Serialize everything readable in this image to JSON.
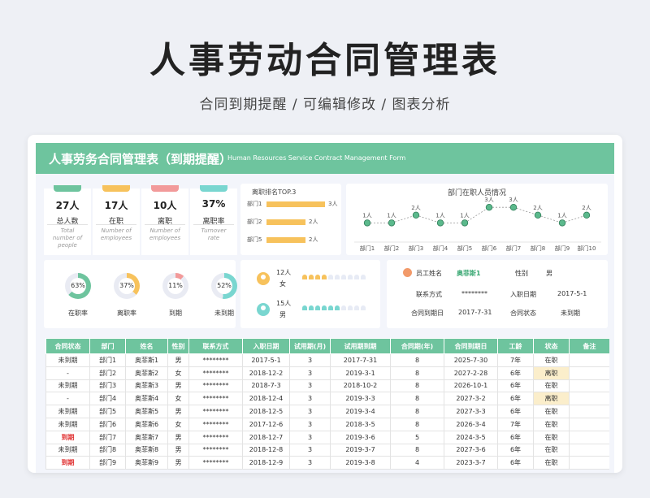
{
  "page": {
    "title": "人事劳动合同管理表",
    "subtitle": "合同到期提醒 /  可编辑修改  /  图表分析"
  },
  "banner": {
    "title": "人事劳务合同管理表（到期提醒）",
    "subtitle": "Human Resources Service Contract Management Form"
  },
  "kpis": [
    {
      "value": "27人",
      "label": "总人数",
      "en": "Total number of people",
      "color": "#6ec49e"
    },
    {
      "value": "17人",
      "label": "在职",
      "en": "Number of employees",
      "color": "#f7c25c"
    },
    {
      "value": "10人",
      "label": "离职",
      "en": "Number of employees",
      "color": "#f29a9a"
    },
    {
      "value": "37%",
      "label": "离职率",
      "en": "Turnover rate",
      "color": "#79d6d0"
    }
  ],
  "top3": {
    "title": "离职排名TOP.3",
    "items": [
      {
        "name": "部门1",
        "value": 3,
        "label": "3人"
      },
      {
        "name": "部门2",
        "value": 2,
        "label": "2人"
      },
      {
        "name": "部门5",
        "value": 2,
        "label": "2人"
      }
    ],
    "color": "#f7c25c"
  },
  "chart_data": {
    "type": "line",
    "title": "部门在职人员情况",
    "categories": [
      "部门1",
      "部门2",
      "部门3",
      "部门4",
      "部门5",
      "部门6",
      "部门7",
      "部门8",
      "部门9",
      "部门10"
    ],
    "values": [
      1,
      1,
      2,
      1,
      1,
      3,
      3,
      2,
      1,
      2
    ],
    "labels": [
      "1人",
      "1人",
      "2人",
      "1人",
      "1人",
      "3人",
      "3人",
      "2人",
      "1人",
      "2人"
    ],
    "color": "#5bb98c",
    "ylim": [
      0,
      3
    ]
  },
  "donuts": [
    {
      "percent": 63,
      "text": "63%",
      "label": "在职率",
      "color": "#6ec49e"
    },
    {
      "percent": 37,
      "text": "37%",
      "label": "离职率",
      "color": "#f7c25c"
    },
    {
      "percent": 11,
      "text": "11%",
      "label": "到期",
      "color": "#f29a9a"
    },
    {
      "percent": 52,
      "text": "52%",
      "label": "未到期",
      "color": "#79d6d0"
    }
  ],
  "gender": [
    {
      "count": "12人",
      "label": "女",
      "color": "#f7c25c",
      "fraction": 0.44
    },
    {
      "count": "15人",
      "label": "男",
      "color": "#79d6d0",
      "fraction": 0.56
    }
  ],
  "info": {
    "name_label": "员工姓名",
    "name_value": "奥菲斯1",
    "gender_label": "性别",
    "gender_value": "男",
    "contact_label": "联系方式",
    "contact_value": "********",
    "entry_label": "入职日期",
    "entry_value": "2017-5-1",
    "expire_label": "合同到期日",
    "expire_value": "2017-7-31",
    "status_label": "合同状态",
    "status_value": "未到期"
  },
  "table": {
    "headers": [
      "合同状态",
      "部门",
      "姓名",
      "性别",
      "联系方式",
      "入职日期",
      "试用期(月)",
      "试用期到期",
      "合同期(年)",
      "合同到期日",
      "工龄",
      "状态",
      "备注"
    ],
    "rows": [
      [
        "未到期",
        "部门1",
        "奥菲斯1",
        "男",
        "********",
        "2017-5-1",
        "3",
        "2017-7-31",
        "8",
        "2025-7-30",
        "7年",
        "在职",
        ""
      ],
      [
        "-",
        "部门2",
        "奥菲斯2",
        "女",
        "********",
        "2018-12-2",
        "3",
        "2019-3-1",
        "8",
        "2027-2-28",
        "6年",
        "离职",
        ""
      ],
      [
        "未到期",
        "部门3",
        "奥菲斯3",
        "男",
        "********",
        "2018-7-3",
        "3",
        "2018-10-2",
        "8",
        "2026-10-1",
        "6年",
        "在职",
        ""
      ],
      [
        "-",
        "部门4",
        "奥菲斯4",
        "女",
        "********",
        "2018-12-4",
        "3",
        "2019-3-3",
        "8",
        "2027-3-2",
        "6年",
        "离职",
        ""
      ],
      [
        "未到期",
        "部门5",
        "奥菲斯5",
        "男",
        "********",
        "2018-12-5",
        "3",
        "2019-3-4",
        "8",
        "2027-3-3",
        "6年",
        "在职",
        ""
      ],
      [
        "未到期",
        "部门6",
        "奥菲斯6",
        "女",
        "********",
        "2017-12-6",
        "3",
        "2018-3-5",
        "8",
        "2026-3-4",
        "7年",
        "在职",
        ""
      ],
      [
        "到期",
        "部门7",
        "奥菲斯7",
        "男",
        "********",
        "2018-12-7",
        "3",
        "2019-3-6",
        "5",
        "2024-3-5",
        "6年",
        "在职",
        ""
      ],
      [
        "未到期",
        "部门8",
        "奥菲斯8",
        "男",
        "********",
        "2018-12-8",
        "3",
        "2019-3-7",
        "8",
        "2027-3-6",
        "6年",
        "在职",
        ""
      ],
      [
        "到期",
        "部门9",
        "奥菲斯9",
        "男",
        "********",
        "2018-12-9",
        "3",
        "2019-3-8",
        "4",
        "2023-3-7",
        "6年",
        "在职",
        ""
      ]
    ]
  }
}
